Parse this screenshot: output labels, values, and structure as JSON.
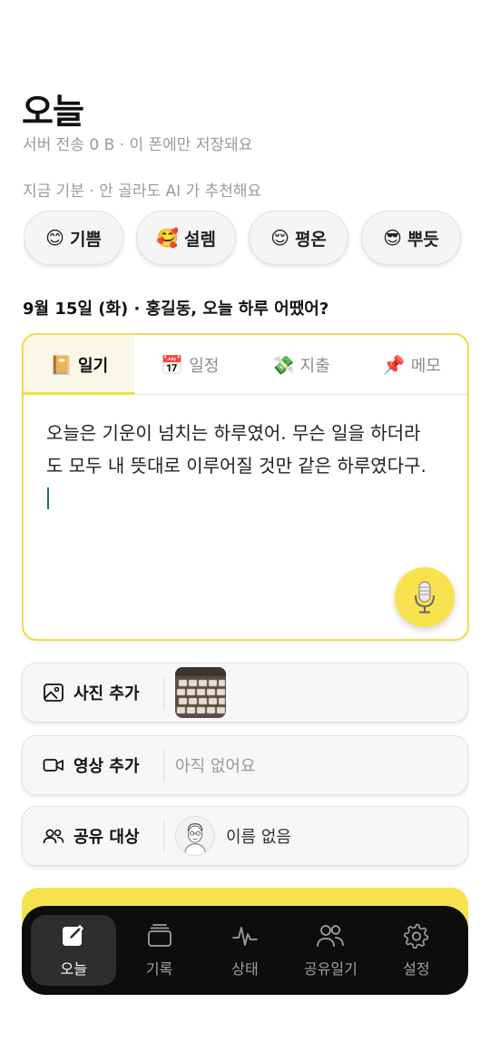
{
  "header": {
    "title": "오늘",
    "subtitle": "서버 전송 0 B · 이 폰에만 저장돼요"
  },
  "mood": {
    "hint": "지금 기분 · 안 골라도 AI 가 추천해요",
    "chips": [
      {
        "emoji": "😊",
        "label": "기쁨"
      },
      {
        "emoji": "🥰",
        "label": "설렘"
      },
      {
        "emoji": "😌",
        "label": "평온"
      },
      {
        "emoji": "😎",
        "label": "뿌듯"
      }
    ]
  },
  "date_prompt": "9월 15일 (화) · 홍길동, 오늘 하루 어땠어?",
  "editor": {
    "tabs": [
      {
        "emoji": "📔",
        "label": "일기"
      },
      {
        "emoji": "📅",
        "label": "일정"
      },
      {
        "emoji": "💸",
        "label": "지출"
      },
      {
        "emoji": "📌",
        "label": "메모"
      }
    ],
    "active_tab": "일기",
    "text": "오늘은 기운이 넘치는 하루였어. 무슨 일을 하더라도 모두 내 뜻대로 이루어질 것만 같은 하루였다구."
  },
  "attachments": {
    "photo_label": "사진 추가",
    "video_label": "영상 추가",
    "video_value": "아직 없어요",
    "share_label": "공유 대상",
    "share_value": "이름 없음"
  },
  "nav": {
    "items": [
      {
        "label": "오늘",
        "icon": "pencil-square-icon"
      },
      {
        "label": "기록",
        "icon": "stack-icon"
      },
      {
        "label": "상태",
        "icon": "pulse-icon"
      },
      {
        "label": "공유일기",
        "icon": "people-icon"
      },
      {
        "label": "설정",
        "icon": "gear-icon"
      }
    ],
    "active": "오늘"
  },
  "colors": {
    "accent": "#f7e24e",
    "card_border": "#f2dc4e",
    "caret": "#1b7a6d",
    "nav_bg": "#0d0d0d"
  }
}
